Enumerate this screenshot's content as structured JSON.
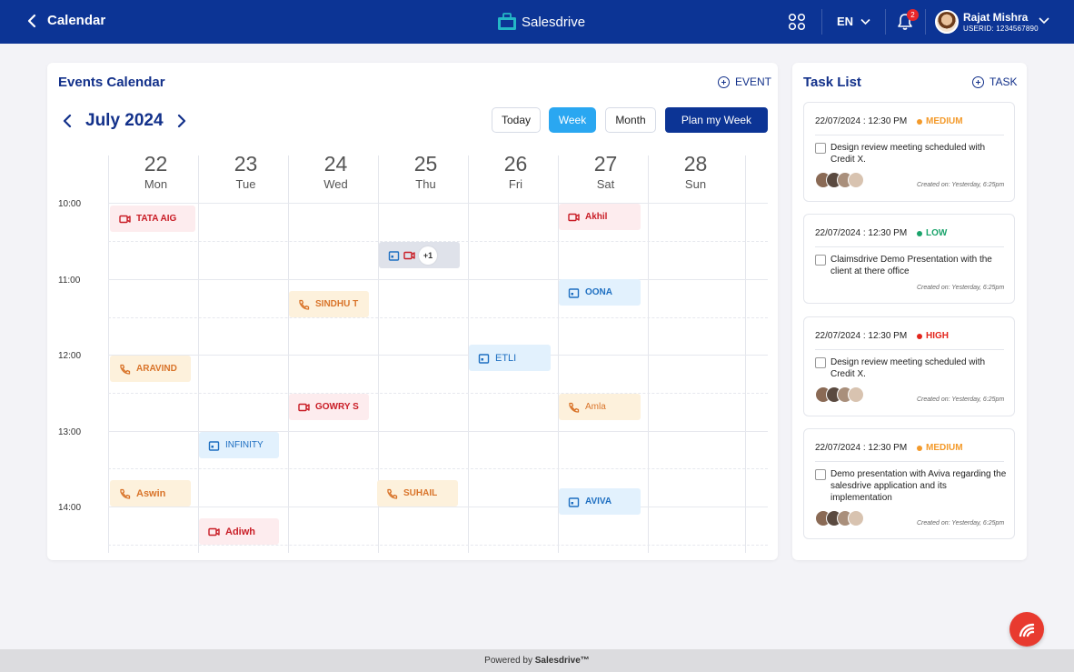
{
  "header": {
    "back_label": "Calendar",
    "brand": "Salesdrive",
    "language": "EN",
    "notification_count": "2",
    "user_name": "Rajat Mishra",
    "user_id": "USERID: 1234567890",
    "bg_color": "#0c3495"
  },
  "calendar": {
    "title": "Events Calendar",
    "add_event_label": "EVENT",
    "month_label": "July 2024",
    "today_label": "Today",
    "week_label": "Week",
    "month_view_label": "Month",
    "plan_label": "Plan my Week",
    "days": [
      {
        "num": "22",
        "name": "Mon"
      },
      {
        "num": "23",
        "name": "Tue"
      },
      {
        "num": "24",
        "name": "Wed"
      },
      {
        "num": "25",
        "name": "Thu"
      },
      {
        "num": "26",
        "name": "Fri"
      },
      {
        "num": "27",
        "name": "Sat"
      },
      {
        "num": "28",
        "name": "Sun"
      }
    ],
    "times": [
      "10:00",
      "11:00",
      "12:00",
      "13:00",
      "14:00"
    ],
    "events": [
      {
        "label": "TATA AIG",
        "type": "video",
        "color": "red"
      },
      {
        "label": "Akhil",
        "type": "video",
        "color": "red"
      },
      {
        "label": "+1",
        "type": "multi",
        "color": "grey"
      },
      {
        "label": "SINDHU T",
        "type": "phone",
        "color": "orange"
      },
      {
        "label": "OONA",
        "type": "calendar",
        "color": "blue"
      },
      {
        "label": "ARAVIND",
        "type": "phone",
        "color": "orange"
      },
      {
        "label": "ETLI",
        "type": "calendar",
        "color": "blue"
      },
      {
        "label": "GOWRY S",
        "type": "video",
        "color": "red"
      },
      {
        "label": "Amla",
        "type": "phone",
        "color": "orange"
      },
      {
        "label": "INFINITY",
        "type": "calendar",
        "color": "blue"
      },
      {
        "label": "Aswin",
        "type": "phone",
        "color": "orange"
      },
      {
        "label": "SUHAIL",
        "type": "phone",
        "color": "orange"
      },
      {
        "label": "AVIVA",
        "type": "calendar",
        "color": "blue"
      },
      {
        "label": "Adiwh",
        "type": "video",
        "color": "red"
      }
    ]
  },
  "tasks": {
    "title": "Task List",
    "add_task_label": "TASK",
    "items": [
      {
        "datetime": "22/07/2024 : 12:30 PM",
        "priority": "MEDIUM",
        "priority_color": "#f39a2b",
        "text": "Design review meeting scheduled with Credit X.",
        "created": "Created on: Yesterday, 6:25pm"
      },
      {
        "datetime": "22/07/2024 : 12:30 PM",
        "priority": "LOW",
        "priority_color": "#1aa36b",
        "text": "Claimsdrive Demo Presentation with the client at there office",
        "created": "Created on: Yesterday, 6:25pm"
      },
      {
        "datetime": "22/07/2024 : 12:30 PM",
        "priority": "HIGH",
        "priority_color": "#e3251c",
        "text": "Design review meeting scheduled with Credit X.",
        "created": "Created on: Yesterday, 6:25pm"
      },
      {
        "datetime": "22/07/2024 : 12:30 PM",
        "priority": "MEDIUM",
        "priority_color": "#f39a2b",
        "text": "Demo presentation with Aviva regarding the salesdrive application and its implementation",
        "created": "Created on: Yesterday, 6:25pm"
      }
    ]
  },
  "footer": {
    "prefix": "Powered by ",
    "brand": "Salesdrive™"
  }
}
